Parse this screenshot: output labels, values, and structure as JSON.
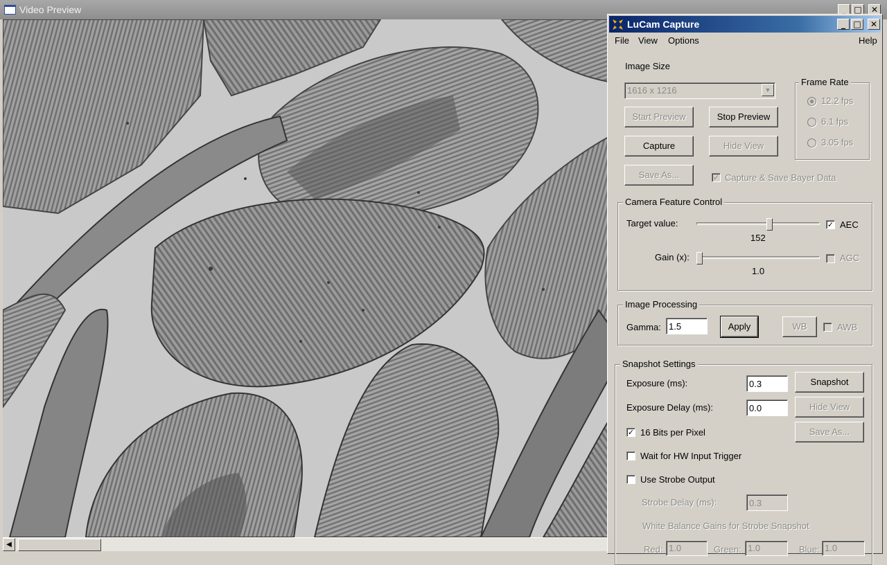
{
  "preview": {
    "title": "Video Preview",
    "controls": {
      "minimize": "_",
      "maximize": "□",
      "close": "✕"
    },
    "scroll_left": "◀"
  },
  "lucam": {
    "title": "LuCam Capture",
    "controls": {
      "minimize": "_",
      "maximize": "□",
      "close": "✕"
    },
    "menu": {
      "file": "File",
      "view": "View",
      "options": "Options",
      "help": "Help"
    },
    "image_size": {
      "label": "Image Size",
      "selected": "1616 x 1216",
      "dropdown_arrow": "▼"
    },
    "frame_rate": {
      "title": "Frame Rate",
      "options": [
        "12.2 fps",
        "6.1 fps",
        "3.05 fps"
      ],
      "selected_index": 0
    },
    "buttons": {
      "start_preview": "Start Preview",
      "stop_preview": "Stop Preview",
      "capture": "Capture",
      "hide_view": "Hide View",
      "save_as": "Save As..."
    },
    "bayer": {
      "label": "Capture & Save Bayer Data",
      "checked": true,
      "check_mark": "✓"
    },
    "camera_feature": {
      "title": "Camera Feature Control",
      "target_label": "Target value:",
      "target_value": "152",
      "target_level": 0.6,
      "aec_label": "AEC",
      "aec_mark": "✓",
      "gain_label": "Gain (x):",
      "gain_value": "1.0",
      "gain_level": 0.0,
      "agc_label": "AGC"
    },
    "image_processing": {
      "title": "Image Processing",
      "gamma_label": "Gamma:",
      "gamma_value": "1.5",
      "apply": "Apply",
      "wb": "WB",
      "awb_label": "AWB"
    },
    "snapshot": {
      "title": "Snapshot Settings",
      "exposure_label": "Exposure (ms):",
      "exposure_value": "0.3",
      "snapshot_button": "Snapshot",
      "delay_label": "Exposure Delay (ms):",
      "delay_value": "0.0",
      "hide_view": "Hide View",
      "bits_label": "16 Bits per Pixel",
      "bits_mark": "✓",
      "save_as": "Save As...",
      "hw_trigger_label": "Wait for HW Input Trigger",
      "strobe_label": "Use Strobe Output",
      "strobe_delay_label": "Strobe Delay (ms):",
      "strobe_delay_value": "0.3",
      "wb_gains_label": "White Balance Gains for Strobe Snapshot",
      "red_label": "Red:",
      "red_value": "1.0",
      "green_label": "Green:",
      "green_value": "1.0",
      "blue_label": "Blue:",
      "blue_value": "1.0"
    },
    "logo_colors": [
      "#f5b400",
      "#f5b400",
      "#f5b400",
      "#f5b400"
    ]
  }
}
